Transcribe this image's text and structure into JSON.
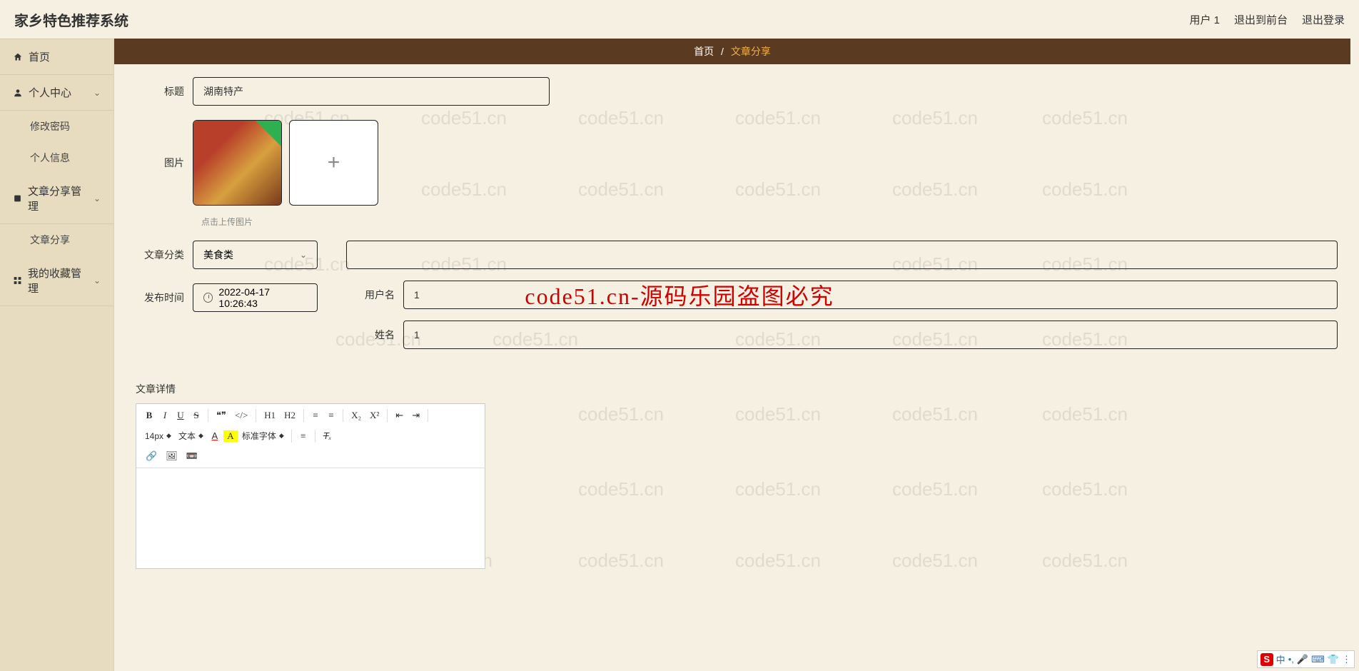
{
  "app": {
    "title": "家乡特色推荐系统"
  },
  "topbar": {
    "user": "用户 1",
    "frontend": "退出到前台",
    "logout": "退出登录"
  },
  "sidebar": {
    "home": "首页",
    "personal": "个人中心",
    "changePwd": "修改密码",
    "profile": "个人信息",
    "articleMgmt": "文章分享管理",
    "articleShare": "文章分享",
    "favMgmt": "我的收藏管理"
  },
  "breadcrumb": {
    "home": "首页",
    "sep": "/",
    "current": "文章分享"
  },
  "form": {
    "titleLabel": "标题",
    "titleValue": "湖南特产",
    "imageLabel": "图片",
    "uploadHint": "点击上传图片",
    "categoryLabel": "文章分类",
    "categoryValue": "美食类",
    "publishLabel": "发布时间",
    "publishValue": "2022-04-17 10:26:43",
    "usernameLabel": "用户名",
    "usernameValue": "1",
    "nameLabel": "姓名",
    "nameValue": "1",
    "detailLabel": "文章详情"
  },
  "editor": {
    "fontSize": "14px",
    "textMode": "文本",
    "fontFamily": "标准字体",
    "h1": "H1",
    "h2": "H2"
  },
  "watermark": "code51.cn",
  "overlay": "code51.cn-源码乐园盗图必究",
  "ime": {
    "s": "S",
    "cn": "中"
  }
}
